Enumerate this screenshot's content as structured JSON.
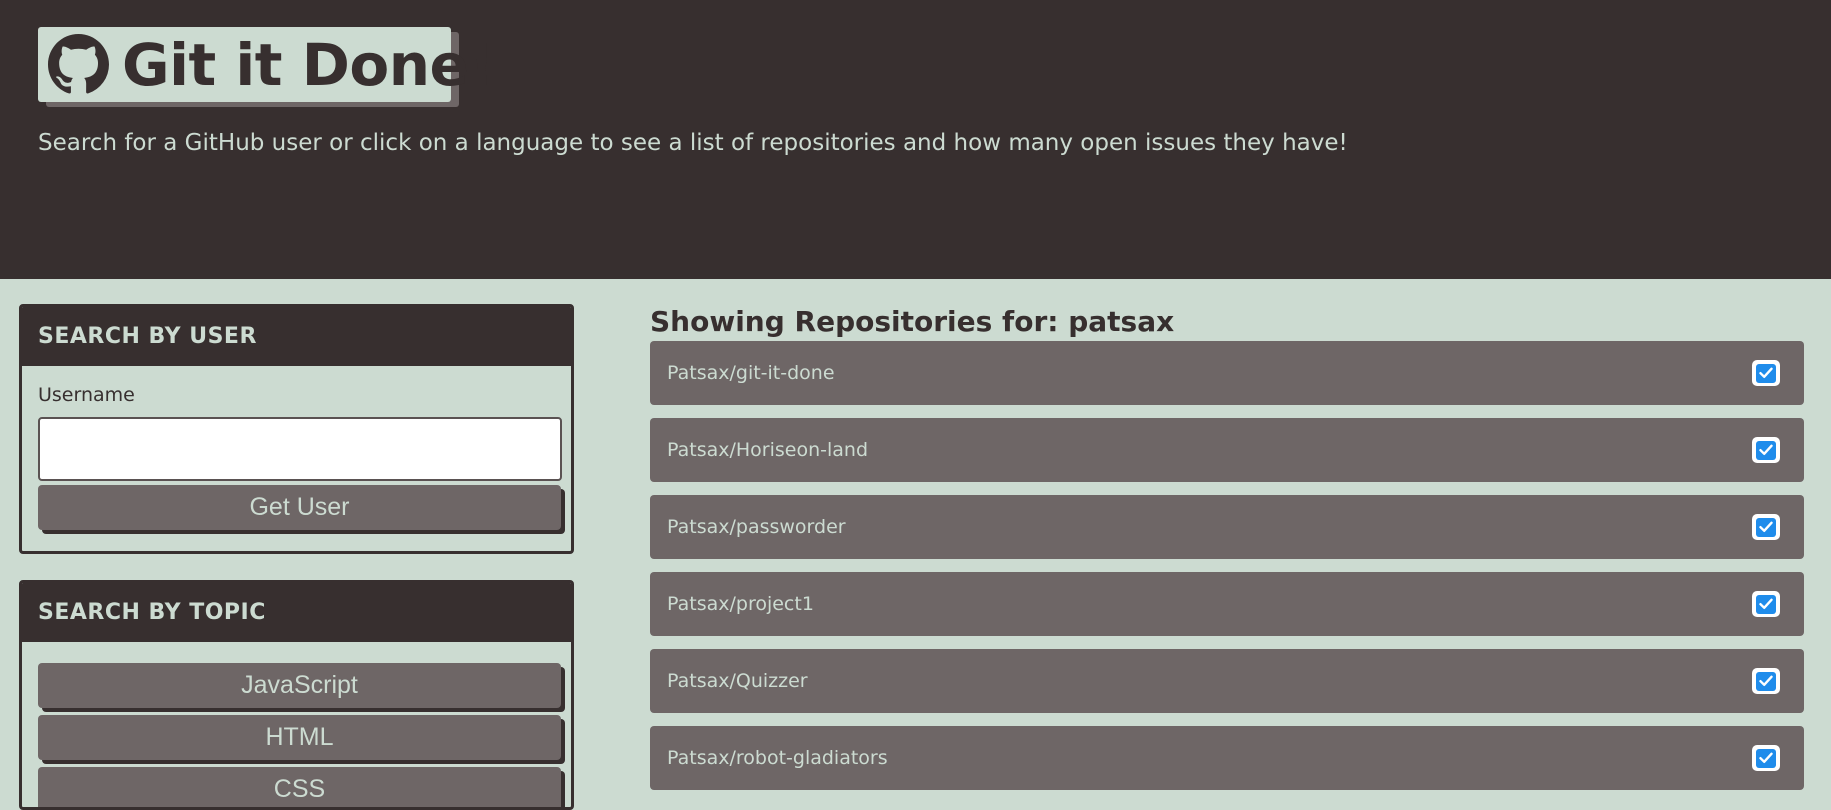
{
  "header": {
    "logo_icon": "github-icon",
    "title": "Git it Done!",
    "subtitle": "Search for a GitHub user or click on a language to see a list of repositories and how many open issues they have!"
  },
  "user_search": {
    "heading": "SEARCH BY USER",
    "field_label": "Username",
    "field_value": "",
    "placeholder": "",
    "button_label": "Get User"
  },
  "topic_search": {
    "heading": "SEARCH BY TOPIC",
    "topics": [
      "JavaScript",
      "HTML",
      "CSS"
    ]
  },
  "results": {
    "title": "Showing Repositories for: patsax",
    "status_icon": "check-square-icon",
    "repos": [
      {
        "name": "Patsax/git-it-done"
      },
      {
        "name": "Patsax/Horiseon-land"
      },
      {
        "name": "Patsax/passworder"
      },
      {
        "name": "Patsax/project1"
      },
      {
        "name": "Patsax/Quizzer"
      },
      {
        "name": "Patsax/robot-gladiators"
      }
    ]
  },
  "colors": {
    "header_bg": "#372f2f",
    "page_bg": "#ccdbd1",
    "item_bg": "#6e6666",
    "check_accent": "#1f8ceb"
  }
}
